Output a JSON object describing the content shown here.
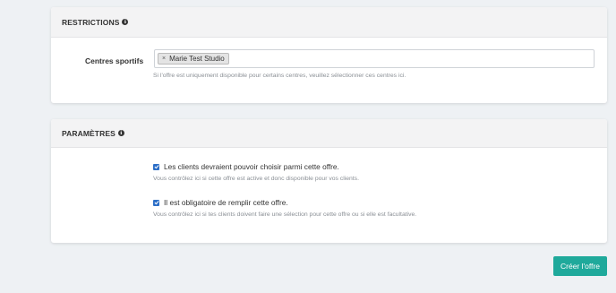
{
  "restrictions": {
    "header_title": "RESTRICTIONS",
    "info_icon": "i",
    "field_label": "Centres sportifs",
    "selected_tags": [
      {
        "remove_symbol": "×",
        "label": "Marie Test Studio"
      }
    ],
    "help_text": "Si l'offre est uniquement disponible pour certains centres, veuillez sélectionner ces centres ici."
  },
  "parametres": {
    "header_title": "PARAMÈTRES",
    "info_icon": "i",
    "options": [
      {
        "label": "Les clients devraient pouvoir choisir parmi cette offre.",
        "checked": true,
        "help_text": "Vous contrôlez ici si cette offre est active et donc disponible pour vos clients."
      },
      {
        "label": "Il est obligatoire de remplir cette offre.",
        "checked": true,
        "help_text": "Vous contrôlez ici si tes clients doivent faire une sélection pour cette offre ou si elle est facultative."
      }
    ]
  },
  "actions": {
    "create_label": "Créer l'offre"
  },
  "colors": {
    "accent": "#1fa99b",
    "checkbox": "#2d6fc7",
    "background": "#eef1f4"
  }
}
